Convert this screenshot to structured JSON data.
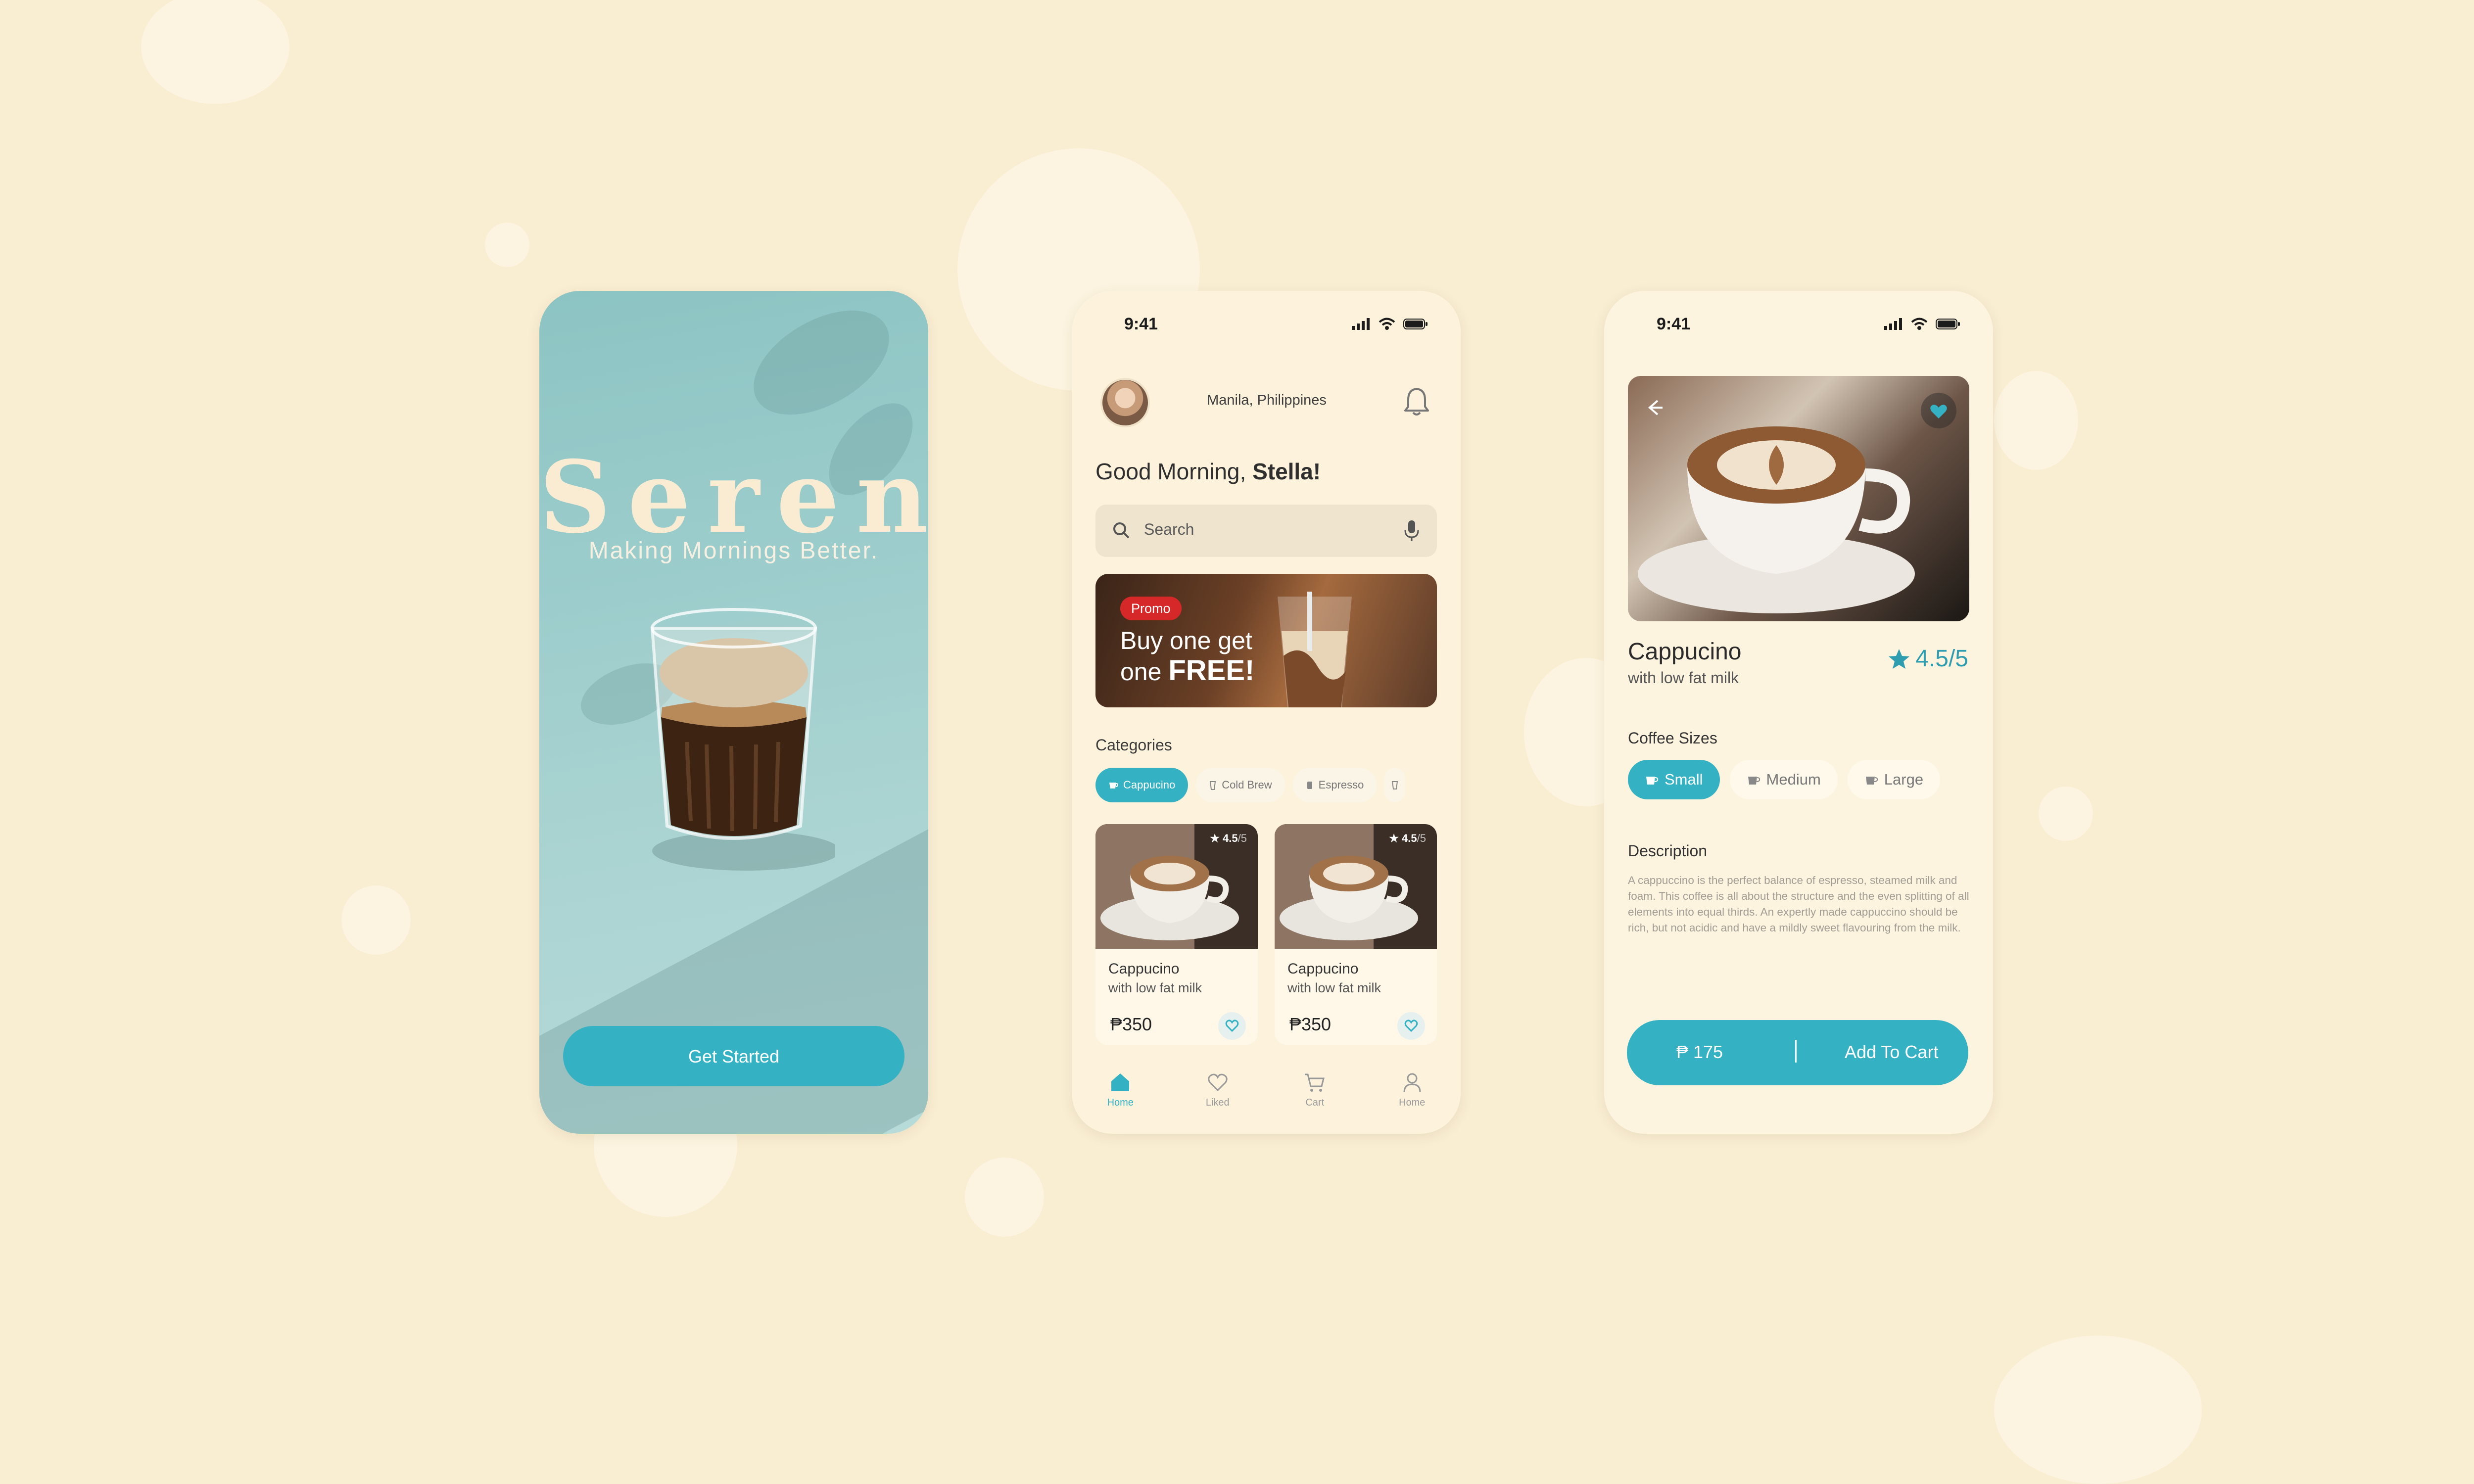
{
  "colors": {
    "accent": "#34b1c2",
    "background": "#f9edd2",
    "promo_badge": "#d62828"
  },
  "splash": {
    "brand": "Serene",
    "tagline": "Making Mornings Better.",
    "cta": "Get Started"
  },
  "status": {
    "time": "9:41"
  },
  "home": {
    "location": "Manila, Philippines",
    "greeting_prefix": "Good Morning,",
    "greeting_name": "Stella!",
    "search_placeholder": "Search",
    "promo": {
      "badge": "Promo",
      "line1": "Buy one get",
      "line2_prefix": "one",
      "line2_bold": "FREE!"
    },
    "categories_title": "Categories",
    "categories": [
      {
        "label": "Cappucino",
        "icon": "cup-icon",
        "active": true
      },
      {
        "label": "Cold Brew",
        "icon": "cold-brew-icon",
        "active": false
      },
      {
        "label": "Espresso",
        "icon": "espresso-icon",
        "active": false
      }
    ],
    "products": [
      {
        "name": "Cappucino",
        "subtitle": "with low fat milk",
        "price": "₱350",
        "rating": "4.5",
        "rating_out_of": "/5"
      },
      {
        "name": "Cappucino",
        "subtitle": "with low fat milk",
        "price": "₱350",
        "rating": "4.5",
        "rating_out_of": "/5"
      }
    ],
    "tabs": [
      {
        "label": "Home",
        "icon": "home-icon",
        "active": true
      },
      {
        "label": "Liked",
        "icon": "heart-icon",
        "active": false
      },
      {
        "label": "Cart",
        "icon": "cart-icon",
        "active": false
      },
      {
        "label": "Home",
        "icon": "user-icon",
        "active": false
      }
    ]
  },
  "detail": {
    "name": "Cappucino",
    "subtitle": "with low fat milk",
    "rating": "4.5/5",
    "sizes_title": "Coffee Sizes",
    "sizes": [
      {
        "label": "Small",
        "active": true
      },
      {
        "label": "Medium",
        "active": false
      },
      {
        "label": "Large",
        "active": false
      }
    ],
    "description_title": "Description",
    "description": "A cappuccino is the perfect balance of espresso, steamed milk and foam. This coffee is all about the structure and the even splitting of all elements into equal thirds. An expertly made cappuccino should be rich, but not acidic and have a mildly sweet flavouring from the milk.",
    "price": "₱ 175",
    "cta": "Add To Cart"
  }
}
